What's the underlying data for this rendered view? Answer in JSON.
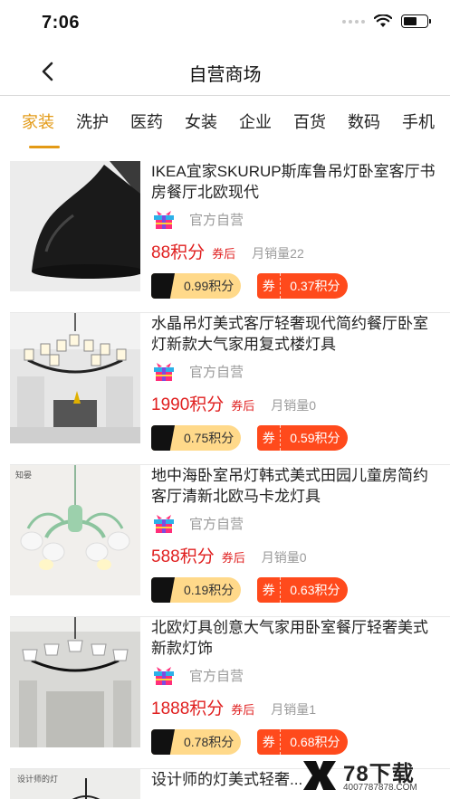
{
  "status_bar": {
    "time": "7:06"
  },
  "nav": {
    "title": "自营商场"
  },
  "tabs": [
    {
      "label": "家装"
    },
    {
      "label": "洗护"
    },
    {
      "label": "医药"
    },
    {
      "label": "女装"
    },
    {
      "label": "企业"
    },
    {
      "label": "百货"
    },
    {
      "label": "数码"
    },
    {
      "label": "手机"
    }
  ],
  "products": [
    {
      "title": "IKEA宜家SKURUP斯库鲁吊灯卧室客厅书房餐厅北欧现代",
      "shop": "官方自营",
      "price": "88积分",
      "after_coupon": "券后",
      "sales": "月销量22",
      "tag_points": "0.99积分",
      "coupon_label": "券",
      "coupon_value": "0.37积分"
    },
    {
      "title": "水晶吊灯美式客厅轻奢现代简约餐厅卧室灯新款大气家用复式楼灯具",
      "shop": "官方自营",
      "price": "1990积分",
      "after_coupon": "券后",
      "sales": "月销量0",
      "tag_points": "0.75积分",
      "coupon_label": "券",
      "coupon_value": "0.59积分"
    },
    {
      "title": "地中海卧室吊灯韩式美式田园儿童房简约客厅清新北欧马卡龙灯具",
      "shop": "官方自营",
      "price": "588积分",
      "after_coupon": "券后",
      "sales": "月销量0",
      "tag_points": "0.19积分",
      "coupon_label": "券",
      "coupon_value": "0.63积分",
      "thumb_label": "知晏"
    },
    {
      "title": "北欧灯具创意大气家用卧室餐厅轻奢美式新款灯饰",
      "shop": "官方自营",
      "price": "1888积分",
      "after_coupon": "券后",
      "sales": "月销量1",
      "tag_points": "0.78积分",
      "coupon_label": "券",
      "coupon_value": "0.68积分"
    },
    {
      "title": "设计师的灯美式轻奢...",
      "shop": "",
      "price": "",
      "after_coupon": "",
      "sales": "",
      "tag_points": "",
      "coupon_label": "",
      "coupon_value": "",
      "thumb_label": "设计师的灯"
    }
  ],
  "watermark": {
    "text": "78下载",
    "phone": "4007787878.COM"
  },
  "colors": {
    "accent": "#e39a16",
    "price": "#e02020",
    "coupon": "#ff4a1c",
    "points_tag": "#ffd98a"
  }
}
